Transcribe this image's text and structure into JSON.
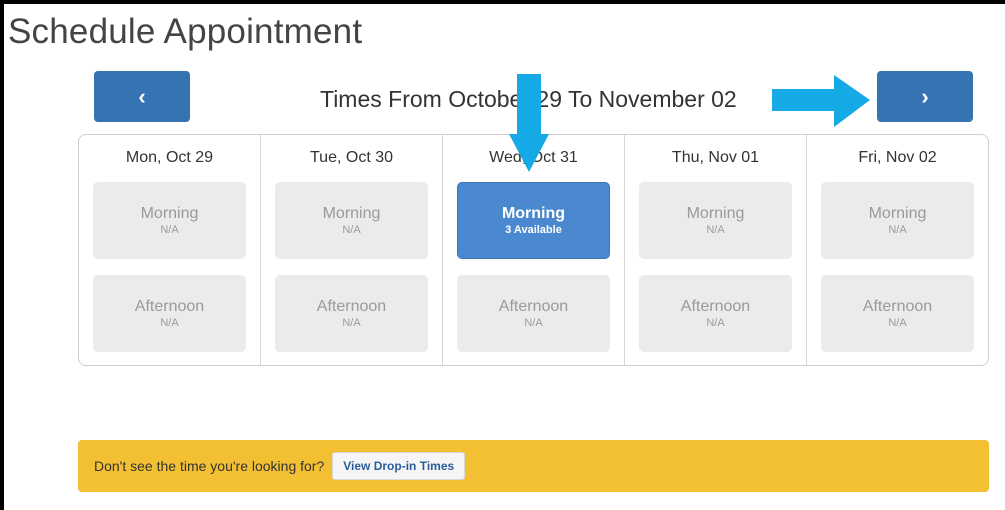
{
  "page": {
    "title": "Schedule Appointment"
  },
  "navigation": {
    "prev_label": "‹",
    "next_label": "›",
    "range_title": "Times From October 29 To November 02"
  },
  "days": [
    {
      "label": "Mon, Oct 29",
      "morning": {
        "name": "Morning",
        "status": "N/A"
      },
      "afternoon": {
        "name": "Afternoon",
        "status": "N/A"
      }
    },
    {
      "label": "Tue, Oct 30",
      "morning": {
        "name": "Morning",
        "status": "N/A"
      },
      "afternoon": {
        "name": "Afternoon",
        "status": "N/A"
      }
    },
    {
      "label": "Wed, Oct 31",
      "morning": {
        "name": "Morning",
        "status": "3 Available"
      },
      "afternoon": {
        "name": "Afternoon",
        "status": "N/A"
      }
    },
    {
      "label": "Thu, Nov 01",
      "morning": {
        "name": "Morning",
        "status": "N/A"
      },
      "afternoon": {
        "name": "Afternoon",
        "status": "N/A"
      }
    },
    {
      "label": "Fri, Nov 02",
      "morning": {
        "name": "Morning",
        "status": "N/A"
      },
      "afternoon": {
        "name": "Afternoon",
        "status": "N/A"
      }
    }
  ],
  "banner": {
    "text": "Don't see the time you're looking for?",
    "button_label": "View Drop-in Times"
  },
  "colors": {
    "nav_button": "#3573b2",
    "available_slot": "#4a89cf",
    "unavailable_slot": "#ebebeb",
    "banner": "#f4c033",
    "annotation_arrow": "#15a9e6"
  },
  "annotations": [
    "arrow-down-icon",
    "arrow-right-icon"
  ]
}
